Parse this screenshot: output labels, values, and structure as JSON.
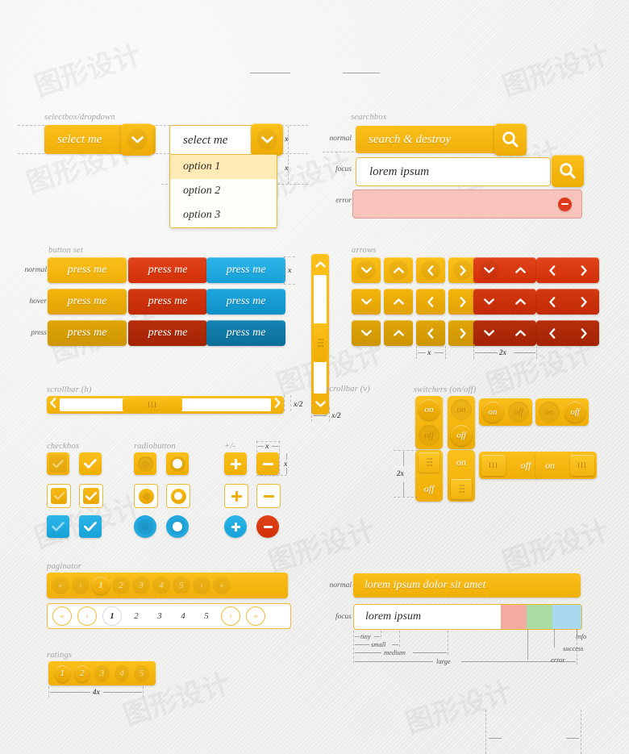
{
  "sections": {
    "selectbox": {
      "caption": "selectbox/dropdown",
      "filled_value": "select me",
      "plain_value": "select me",
      "options": [
        "option 1",
        "option 2",
        "option 3"
      ],
      "selected_index": 0
    },
    "searchbox": {
      "caption": "searchbox",
      "rows": [
        {
          "label": "normal",
          "value": "search & destroy"
        },
        {
          "label": "focus",
          "value": "lorem ipsum"
        },
        {
          "label": "error",
          "value": ""
        }
      ]
    },
    "buttonset": {
      "caption": "button set",
      "labels": [
        "normal",
        "hover",
        "press"
      ],
      "text": "press me",
      "colors": [
        "yellow",
        "red",
        "blue"
      ]
    },
    "arrows": {
      "caption": "arrows",
      "single": [
        "chevron-down",
        "chevron-up",
        "chevron-left",
        "chevron-right"
      ],
      "pairs": [
        [
          "chevron-down",
          "chevron-up"
        ],
        [
          "chevron-left",
          "chevron-right"
        ]
      ],
      "rows": 3,
      "dim_single": "x",
      "dim_pair": "2x"
    },
    "scrollbar_h": {
      "caption": "scrollbar (h)",
      "dim": "x/2"
    },
    "scrollbar_v": {
      "caption": "scrollbar (v)",
      "dim": "x/2"
    },
    "switchers": {
      "caption": "switchers (on/off)",
      "on": "on",
      "off": "off",
      "dim": "2x"
    },
    "checkbox": {
      "caption": "checkbox"
    },
    "radiobutton": {
      "caption": "radiobutton"
    },
    "plusminus": {
      "caption": "+/-",
      "dim_w": "x",
      "dim_h": "x"
    },
    "paginator": {
      "caption": "paginator",
      "first": "«",
      "prev": "‹",
      "next": "›",
      "last": "»",
      "pages": [
        "1",
        "2",
        "3",
        "4",
        "5"
      ],
      "active_page": "1"
    },
    "ratings": {
      "caption": "ratings",
      "items": [
        "1",
        "2",
        "3",
        "4",
        "5"
      ],
      "filled": 2,
      "dim": "4x"
    },
    "textfields": {
      "rows": [
        {
          "label": "normal",
          "value": "lorem ipsum dolor sit amet"
        },
        {
          "label": "focus",
          "value": "lorem ipsum"
        }
      ],
      "sizes": [
        "tiny",
        "small",
        "medium",
        "large"
      ],
      "states": [
        {
          "name": "error",
          "color": "#f3ab9f"
        },
        {
          "name": "success",
          "color": "#a9dca4"
        },
        {
          "name": "info",
          "color": "#a8d9ef"
        }
      ]
    }
  },
  "palette": {
    "yellow": "#f5b610",
    "yellow_dark": "#e2a203",
    "red": "#de3b15",
    "red_dark": "#b62e0c",
    "blue": "#22a8de",
    "blue_dark": "#1179a8",
    "background": "#efefed",
    "error": "#f3ab9f",
    "success": "#a9dca4",
    "info": "#a8d9ef"
  },
  "watermark": "图形设计"
}
